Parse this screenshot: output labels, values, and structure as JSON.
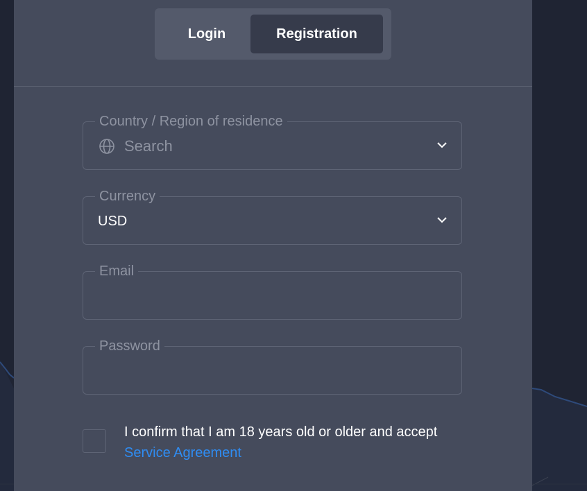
{
  "tabs": {
    "login_label": "Login",
    "registration_label": "Registration",
    "active": "registration"
  },
  "form": {
    "country": {
      "label": "Country / Region of residence",
      "placeholder": "Search",
      "icon": "globe-icon"
    },
    "currency": {
      "label": "Currency",
      "value": "USD"
    },
    "email": {
      "label": "Email",
      "value": ""
    },
    "password": {
      "label": "Password",
      "value": ""
    },
    "consent": {
      "checked": false,
      "text": "I confirm that I am 18 years old or older and accept",
      "link_label": "Service Agreement"
    }
  },
  "colors": {
    "modal_bg": "#454b5c",
    "page_bg": "#1f2433",
    "active_tab_bg": "#363b4b",
    "link": "#2f8df4"
  }
}
